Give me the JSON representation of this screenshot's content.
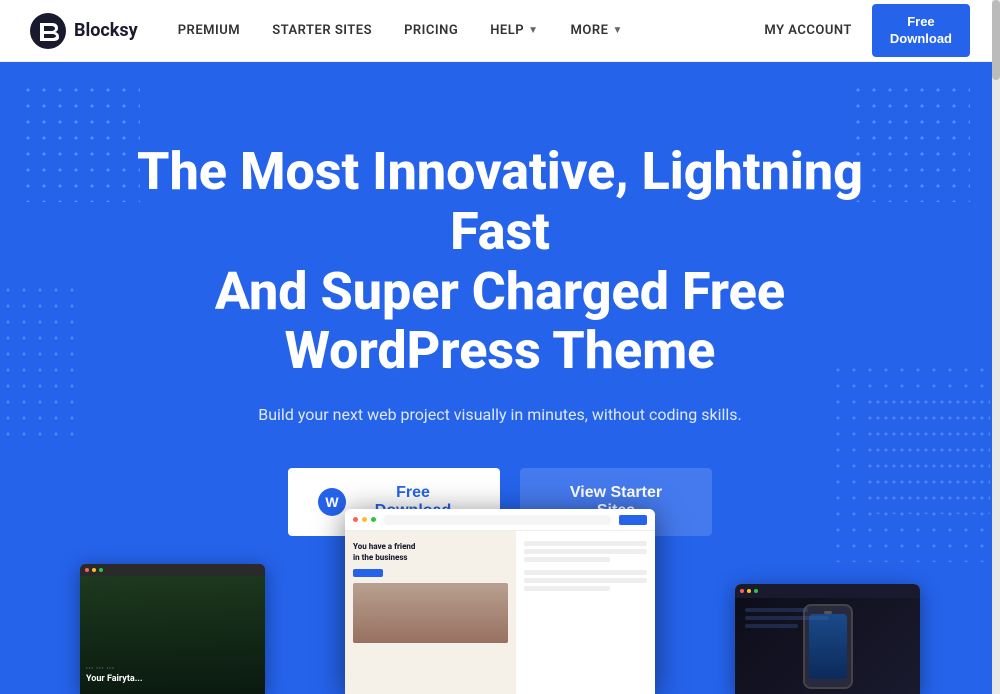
{
  "brand": {
    "name": "Blocksy",
    "logo_icon": "B"
  },
  "navbar": {
    "links": [
      {
        "label": "PREMIUM",
        "has_dropdown": false
      },
      {
        "label": "STARTER SITES",
        "has_dropdown": false
      },
      {
        "label": "PRICING",
        "has_dropdown": false
      },
      {
        "label": "HELP",
        "has_dropdown": true
      },
      {
        "label": "MORE",
        "has_dropdown": true
      }
    ],
    "my_account": "MY ACCOUNT",
    "cta": {
      "line1": "Free",
      "line2": "Download"
    }
  },
  "hero": {
    "title_line1": "The Most Innovative, Lightning Fast",
    "title_line2": "And Super Charged Free WordPress Theme",
    "subtitle": "Build your next web project visually in minutes, without coding skills.",
    "btn_download": "Free Download",
    "btn_starter": "View Starter Sites"
  },
  "screenshots": {
    "left": {
      "title": "Your Fairyta..."
    },
    "center": {
      "tagline_line1": "You have a friend",
      "tagline_line2": "in the business"
    },
    "right": {
      "label": "Phone mockup"
    }
  }
}
